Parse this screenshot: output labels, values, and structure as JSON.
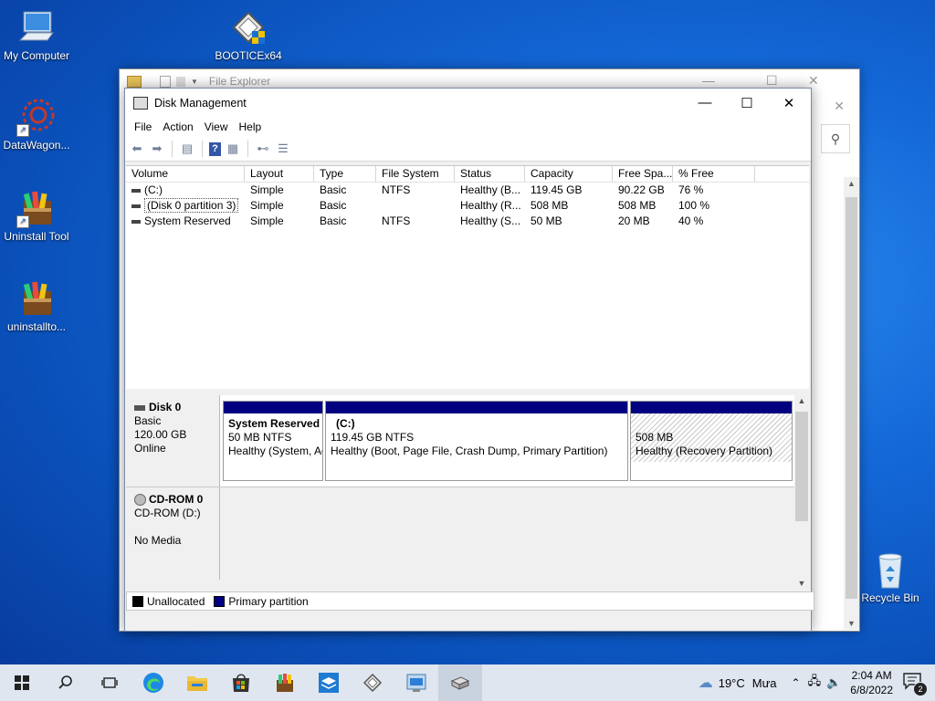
{
  "desktop": {
    "icons": [
      {
        "label": "My Computer"
      },
      {
        "label": "BOOTICEx64"
      },
      {
        "label": "DataWagon..."
      },
      {
        "label": "Uninstall Tool"
      },
      {
        "label": "uninstallto..."
      },
      {
        "label": "Recycle Bin"
      }
    ]
  },
  "explorer": {
    "title": "File Explorer"
  },
  "window": {
    "title": "Disk Management",
    "minimize": "—",
    "maximize": "☐",
    "close": "✕"
  },
  "menu": [
    "File",
    "Action",
    "View",
    "Help"
  ],
  "toolbar": {
    "icons": [
      "back-arrow-icon",
      "forward-arrow-icon",
      "show-hide-console-tree-icon",
      "help-icon",
      "properties-icon",
      "connect-icon",
      "list-view-icon"
    ]
  },
  "volume_list": {
    "columns": [
      "Volume",
      "Layout",
      "Type",
      "File System",
      "Status",
      "Capacity",
      "Free Spa...",
      "% Free"
    ],
    "rows": [
      {
        "volume": "(C:)",
        "layout": "Simple",
        "type": "Basic",
        "fs": "NTFS",
        "status": "Healthy (B...",
        "capacity": "119.45 GB",
        "free": "90.22 GB",
        "pct": "76 %"
      },
      {
        "volume": "(Disk 0 partition 3)",
        "layout": "Simple",
        "type": "Basic",
        "fs": "",
        "status": "Healthy (R...",
        "capacity": "508 MB",
        "free": "508 MB",
        "pct": "100 %"
      },
      {
        "volume": "System Reserved",
        "layout": "Simple",
        "type": "Basic",
        "fs": "NTFS",
        "status": "Healthy (S...",
        "capacity": "50 MB",
        "free": "20 MB",
        "pct": "40 %"
      }
    ]
  },
  "disks": {
    "disk0": {
      "name": "Disk 0",
      "type": "Basic",
      "size": "120.00 GB",
      "state": "Online",
      "partitions": [
        {
          "name": "System Reserved",
          "size": "50 MB NTFS",
          "status": "Healthy (System, Active, Primary Partition)"
        },
        {
          "name": "(C:)",
          "size": "119.45 GB NTFS",
          "status": "Healthy (Boot, Page File, Crash Dump, Primary Partition)"
        },
        {
          "name": "",
          "size": "508 MB",
          "status": "Healthy (Recovery Partition)"
        }
      ]
    },
    "cdrom0": {
      "name": "CD-ROM 0",
      "drive": "CD-ROM (D:)",
      "media": "No Media"
    }
  },
  "legend": {
    "unallocated": "Unallocated",
    "primary": "Primary partition",
    "colors": {
      "unallocated": "#000000",
      "primary": "#000080"
    }
  },
  "taskbar": {
    "weather_temp": "19°C",
    "weather_text": "Mưa",
    "time": "2:04 AM",
    "date": "6/8/2022",
    "notification_count": "2"
  }
}
